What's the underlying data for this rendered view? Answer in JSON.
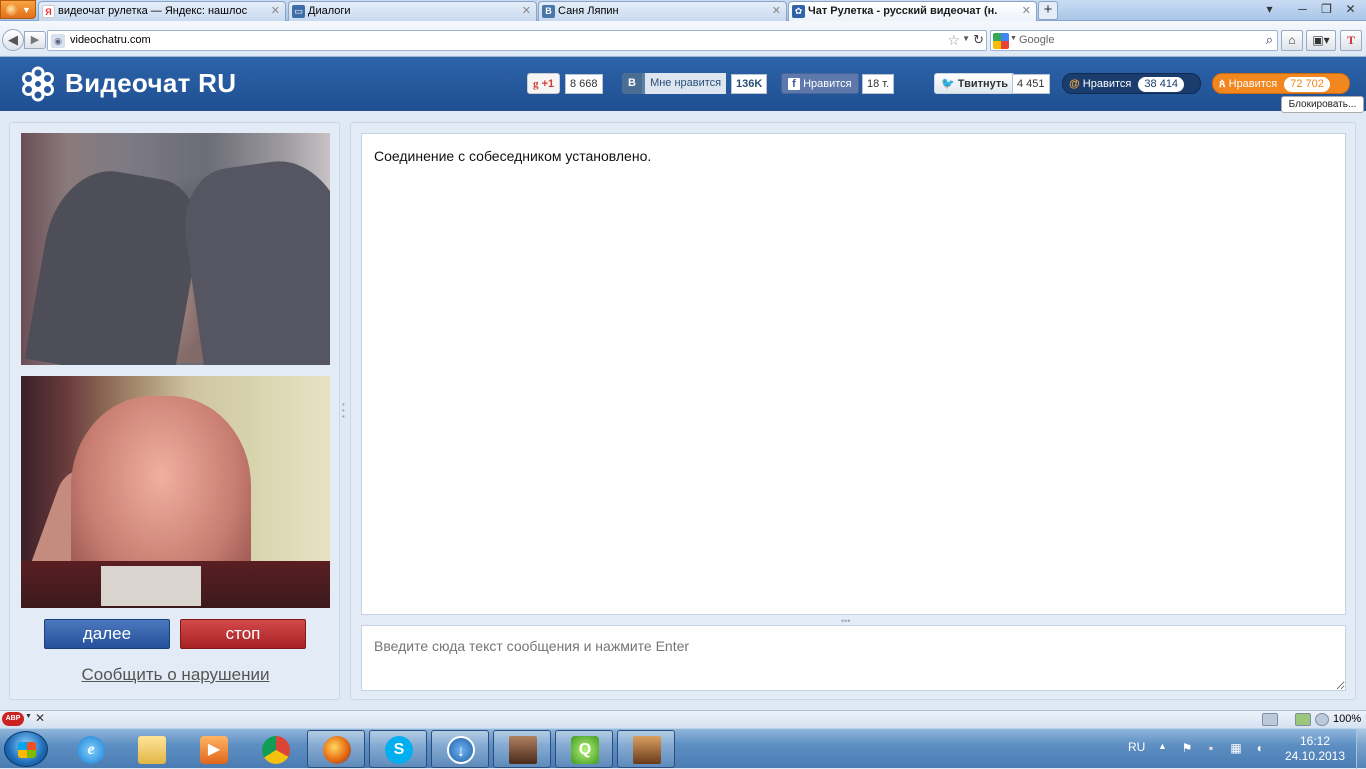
{
  "browser": {
    "tabs": [
      {
        "label": "видеочат рулетка — Яндекс: нашлос...",
        "favicon": "Я",
        "favicon_color": "#e33",
        "active": false
      },
      {
        "label": "Диалоги",
        "favicon": "",
        "favicon_color": "#3d6ea8",
        "active": false
      },
      {
        "label": "Саня Ляпин",
        "favicon": "B",
        "favicon_color": "#4a76a8",
        "active": false
      },
      {
        "label": "Чат Рулетка - русский видеочат (н...",
        "favicon": "",
        "favicon_color": "#2e63a9",
        "active": true
      }
    ],
    "new_tab_label": "+",
    "url": "videochatru.com",
    "search_placeholder": "Google"
  },
  "site": {
    "logo_text": "Видеочат RU",
    "social": {
      "gplus_label": "+1",
      "gplus_count": "8 668",
      "vk_label": "Мне нравится",
      "vk_letter": "B",
      "vk_count": "136K",
      "fb_label": "Нравится",
      "fb_count": "18 т.",
      "tw_label": "Твитнуть",
      "tw_count": "4 451",
      "mail_label": "Нравится",
      "mail_count": "38 414",
      "ok_label": "Нравится",
      "ok_count": "72 702"
    },
    "block_label": "Блокировать..."
  },
  "chat": {
    "next_label": "далее",
    "stop_label": "стоп",
    "report_label": "Сообщить о нарушении",
    "messages": [
      "Соединение с собеседником установлено."
    ],
    "input_placeholder": "Введите сюда текст сообщения и нажмите Enter"
  },
  "addon_bar": {
    "zoom": "100%"
  },
  "taskbar": {
    "language": "RU",
    "time": "16:12",
    "date": "24.10.2013"
  },
  "colors": {
    "header_blue": "#2d63a9",
    "next_blue": "#3563ad",
    "stop_red": "#c03334"
  }
}
